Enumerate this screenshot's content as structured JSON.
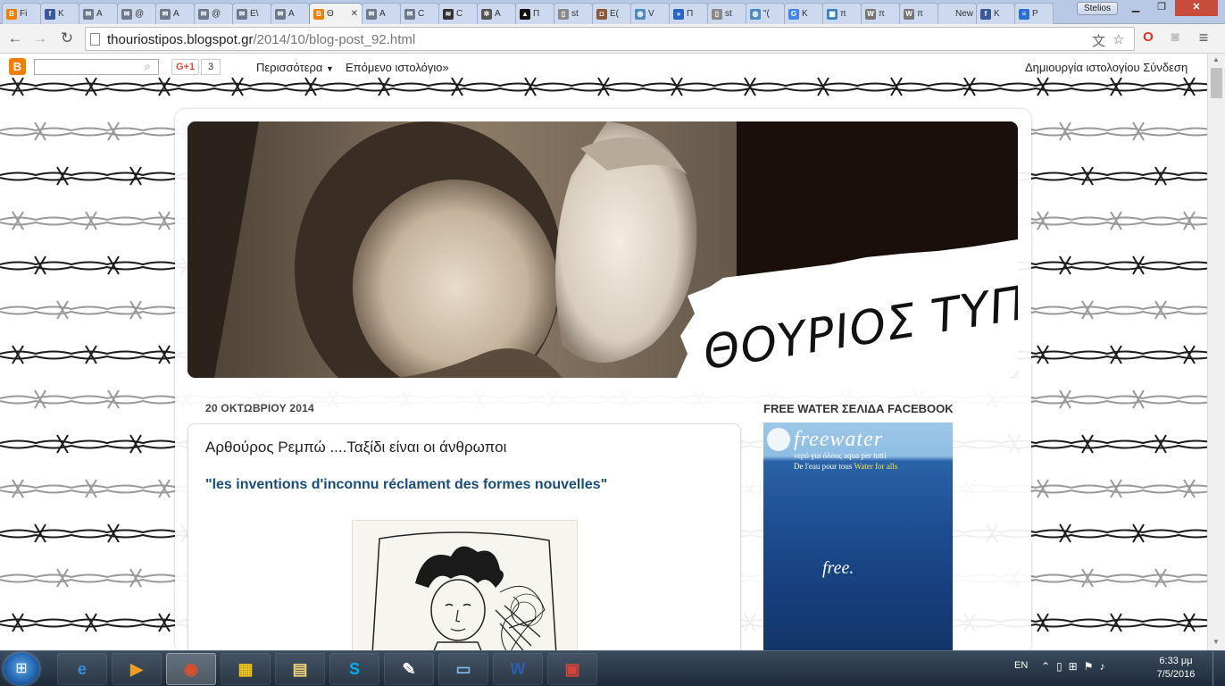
{
  "browser": {
    "tabs": [
      {
        "label": "Fi",
        "icon": "blogger-icon"
      },
      {
        "label": "K",
        "icon": "facebook-icon"
      },
      {
        "label": "A",
        "icon": "mail-icon"
      },
      {
        "label": "@",
        "icon": "mail-icon"
      },
      {
        "label": "A",
        "icon": "mail-icon"
      },
      {
        "label": "@",
        "icon": "mail-icon"
      },
      {
        "label": "E\\",
        "icon": "mail-icon"
      },
      {
        "label": "A",
        "icon": "mail-icon"
      },
      {
        "label": "Θ",
        "icon": "blogger-icon",
        "active": true
      },
      {
        "label": "A",
        "icon": "mail-icon"
      },
      {
        "label": "C",
        "icon": "mail-icon"
      },
      {
        "label": "C",
        "icon": "radio-icon"
      },
      {
        "label": "A",
        "icon": "gear-icon"
      },
      {
        "label": "Π",
        "icon": "triangle-icon"
      },
      {
        "label": "st",
        "icon": "doc-icon"
      },
      {
        "label": "E(",
        "icon": "photo-icon"
      },
      {
        "label": "V",
        "icon": "globe-icon"
      },
      {
        "label": "Π",
        "icon": "arrows-icon"
      },
      {
        "label": "st",
        "icon": "doc-icon"
      },
      {
        "label": "\"(",
        "icon": "globe-icon"
      },
      {
        "label": "K",
        "icon": "google-icon"
      },
      {
        "label": "π",
        "icon": "image-icon"
      },
      {
        "label": "π",
        "icon": "wikipedia-icon"
      },
      {
        "label": "π",
        "icon": "wikipedia-icon"
      },
      {
        "label": "New",
        "icon": "none"
      },
      {
        "label": "K",
        "icon": "facebook-icon"
      },
      {
        "label": "P",
        "icon": "flag-icon"
      }
    ],
    "active_tab_close": "✕",
    "user_name": "Stelios",
    "url_host": "thouriostipos.blogspot.gr",
    "url_path": "/2014/10/blog-post_92.html"
  },
  "blogger_nav": {
    "gplus_label": "G+1",
    "gplus_count": "3",
    "more_label": "Περισσότερα",
    "next_blog_label": "Επόμενο ιστολόγιο»",
    "create_signin_label": "Δημιουργία ιστολογίου   Σύνδεση"
  },
  "header": {
    "blog_title": "ΘΟΥΡΙΟΣ ΤΥΠΟΣ"
  },
  "post": {
    "date": "20 ΟΚΤΩΒΡΙΟΥ 2014",
    "title": "Αρθούρος Ρεμπώ ....Ταξίδι είναι οι άνθρωποι",
    "quote": "\"les inventions d'inconnu réclament des formes nouvelles\""
  },
  "sidebar": {
    "widget_title": "FREE WATER ΣΕΛΙΔΑ FACEBOOK",
    "banner": {
      "brand": "freewater",
      "line1": "νερό για όλους aqua per tutti",
      "line2_white": "De l'eau pour tous ",
      "line2_yellow": "Water for alls",
      "tagline": "free."
    }
  },
  "taskbar": {
    "apps": [
      {
        "name": "internet-explorer",
        "glyph": "e",
        "color": "#2f8fe0"
      },
      {
        "name": "media-player",
        "glyph": "▶",
        "color": "#f0a020"
      },
      {
        "name": "chrome",
        "glyph": "◉",
        "color": "#e44d26",
        "active": true
      },
      {
        "name": "tiles-app",
        "glyph": "▦",
        "color": "#f0c419"
      },
      {
        "name": "file-explorer",
        "glyph": "▤",
        "color": "#f3d27a"
      },
      {
        "name": "skype",
        "glyph": "S",
        "color": "#00aff0"
      },
      {
        "name": "paint",
        "glyph": "✎",
        "color": "#ffffff"
      },
      {
        "name": "photo-viewer",
        "glyph": "▭",
        "color": "#79b6e8"
      },
      {
        "name": "word",
        "glyph": "W",
        "color": "#2b5fad"
      },
      {
        "name": "picture-app",
        "glyph": "▣",
        "color": "#d9443a"
      }
    ],
    "lang": "EN",
    "time": "6:33 μμ",
    "date": "7/5/2016"
  }
}
